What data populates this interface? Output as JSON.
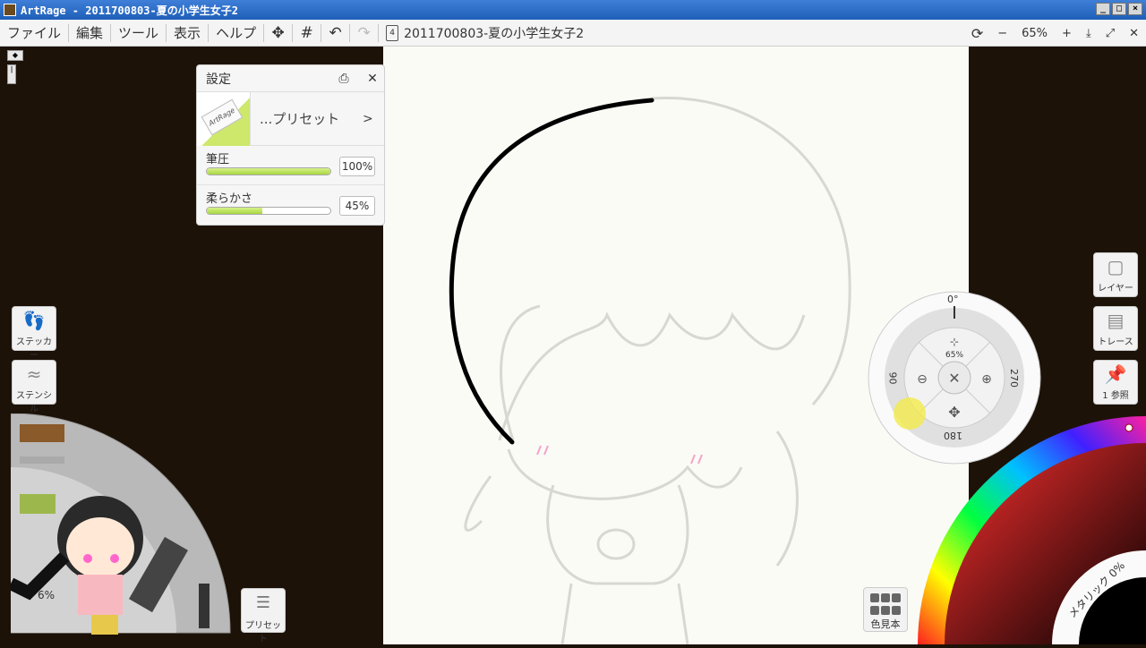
{
  "window": {
    "title": "ArtRage - 2011700803-夏の小学生女子2",
    "controls": [
      "_",
      "□",
      "×"
    ]
  },
  "menu": {
    "items": [
      "ファイル",
      "編集",
      "ツール",
      "表示",
      "ヘルプ"
    ],
    "tool_icons": [
      "move-icon",
      "grid-icon",
      "undo-icon",
      "redo-icon"
    ],
    "document_number": "4",
    "document_name": "2011700803-夏の小学生女子2",
    "zoom_minus": "−",
    "zoom_value": "65%",
    "zoom_plus": "+",
    "close": "✕"
  },
  "settings_panel": {
    "title": "設定",
    "preset_label": "...プリセット",
    "preset_arrow": ">",
    "brand": "ArtRage",
    "pressure_label": "筆圧",
    "pressure_value": "100%",
    "pressure_level": 1.0,
    "softness_label": "柔らかさ",
    "softness_value": "45%",
    "softness_level": 0.45
  },
  "left_tools": {
    "sticker_label": "ステッカー",
    "stencil_label": "ステンシル",
    "tool_size": "6%",
    "preset_button_label": "プリセット"
  },
  "navigator": {
    "angle_top": "0°",
    "angle_left": "90",
    "angle_right": "270",
    "angle_bottom": "180",
    "zoom": "65%"
  },
  "right_panel": {
    "layer_label": "レイヤー",
    "trace_label": "トレース",
    "reference_label": "1 参照",
    "swatch_label": "色見本",
    "metallic_label": "メタリック 0%"
  },
  "colors": {
    "accent_green": "#a8d640",
    "background": "#1d1208",
    "titlebar": "#2a6acb"
  }
}
